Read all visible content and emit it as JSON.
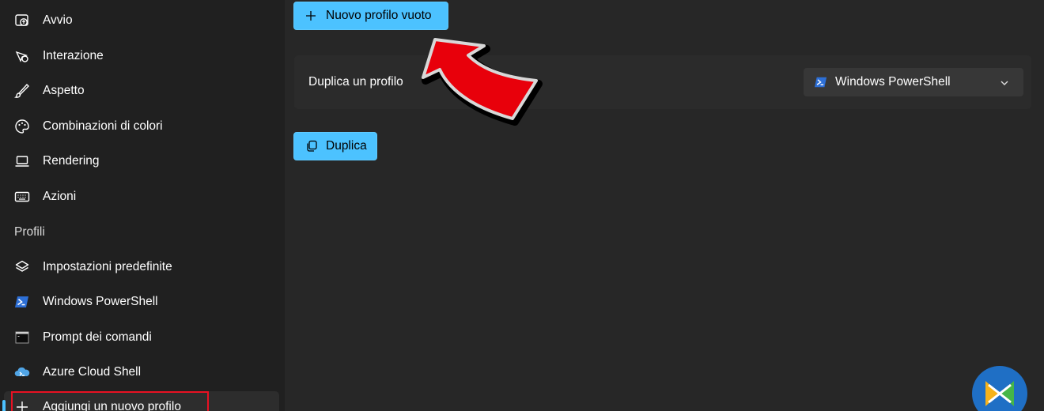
{
  "sidebar": {
    "items_top": [
      {
        "label": "Avvio",
        "icon": "startup-icon"
      },
      {
        "label": "Interazione",
        "icon": "interaction-icon"
      },
      {
        "label": "Aspetto",
        "icon": "brush-icon"
      },
      {
        "label": "Combinazioni di colori",
        "icon": "palette-icon"
      },
      {
        "label": "Rendering",
        "icon": "laptop-icon"
      },
      {
        "label": "Azioni",
        "icon": "keyboard-icon"
      }
    ],
    "profiles_section": "Profili",
    "profiles": [
      {
        "label": "Impostazioni predefinite",
        "icon": "layers-icon"
      },
      {
        "label": "Windows PowerShell",
        "icon": "powershell-icon"
      },
      {
        "label": "Prompt dei comandi",
        "icon": "cmd-icon"
      },
      {
        "label": "Azure Cloud Shell",
        "icon": "azure-icon"
      }
    ],
    "add_profile": {
      "label": "Aggiungi un nuovo profilo",
      "icon": "plus-icon"
    }
  },
  "main": {
    "new_empty_profile_button": "Nuovo profilo vuoto",
    "duplicate_card": {
      "label": "Duplica un profilo",
      "selected_profile": "Windows PowerShell"
    },
    "duplicate_button": "Duplica"
  },
  "colors": {
    "accent": "#4cc2ff",
    "highlight": "#e81123",
    "arrow": "#e8000b"
  }
}
